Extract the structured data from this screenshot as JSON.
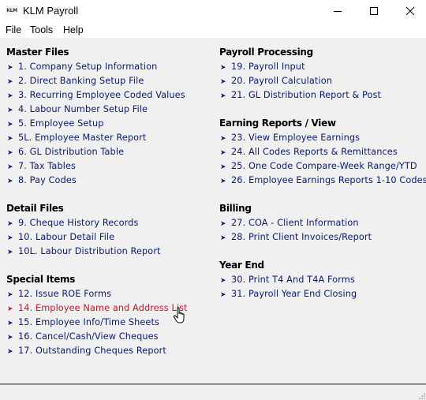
{
  "window": {
    "app_icon_text": "KLM",
    "title": "KLM Payroll",
    "controls": {
      "minimize": "minimize-icon",
      "maximize": "maximize-icon",
      "close": "close-icon"
    }
  },
  "menubar": {
    "items": [
      "File",
      "Tools",
      "Help"
    ]
  },
  "colors": {
    "link": "#0c1a6e",
    "active_link": "#c0182a",
    "background": "#f0f0f0"
  },
  "arrow_glyph": "➤",
  "sections": {
    "master_files": {
      "title": "Master Files",
      "items": [
        "1. Company Setup Information",
        "2. Direct Banking Setup File",
        "3. Recurring Employee Coded Values",
        "4. Labour Number Setup File",
        "5. Employee Setup",
        "5L. Employee Master Report",
        "6. GL Distribution Table",
        "7. Tax Tables",
        "8. Pay Codes"
      ]
    },
    "detail_files": {
      "title": "Detail Files",
      "items": [
        "9. Cheque History Records",
        "10. Labour Detail File",
        "10L. Labour Distribution Report"
      ]
    },
    "special_items": {
      "title": "Special Items",
      "items": [
        "12. Issue ROE Forms",
        "14. Employee Name and Address List",
        "15. Employee Info/Time Sheets",
        "16. Cancel/Cash/View Cheques",
        "17. Outstanding Cheques Report"
      ],
      "hovered_index": 1
    },
    "payroll_processing": {
      "title": "Payroll Processing",
      "items": [
        "19. Payroll Input",
        "20. Payroll Calculation",
        "21. GL Distribution Report & Post"
      ]
    },
    "earning_reports": {
      "title": "Earning Reports / View",
      "items": [
        "23. View Employee Earnings",
        "24. All Codes Reports & Remittances",
        "25. One Code Compare-Week Range/YTD",
        "26. Employee Earnings Reports 1-10 Codes"
      ]
    },
    "billing": {
      "title": "Billing",
      "items": [
        "27. COA - Client Information",
        "28. Print Client Invoices/Report"
      ]
    },
    "year_end": {
      "title": "Year End",
      "items": [
        "30. Print T4 And T4A Forms",
        "31. Payroll Year End Closing"
      ]
    }
  }
}
